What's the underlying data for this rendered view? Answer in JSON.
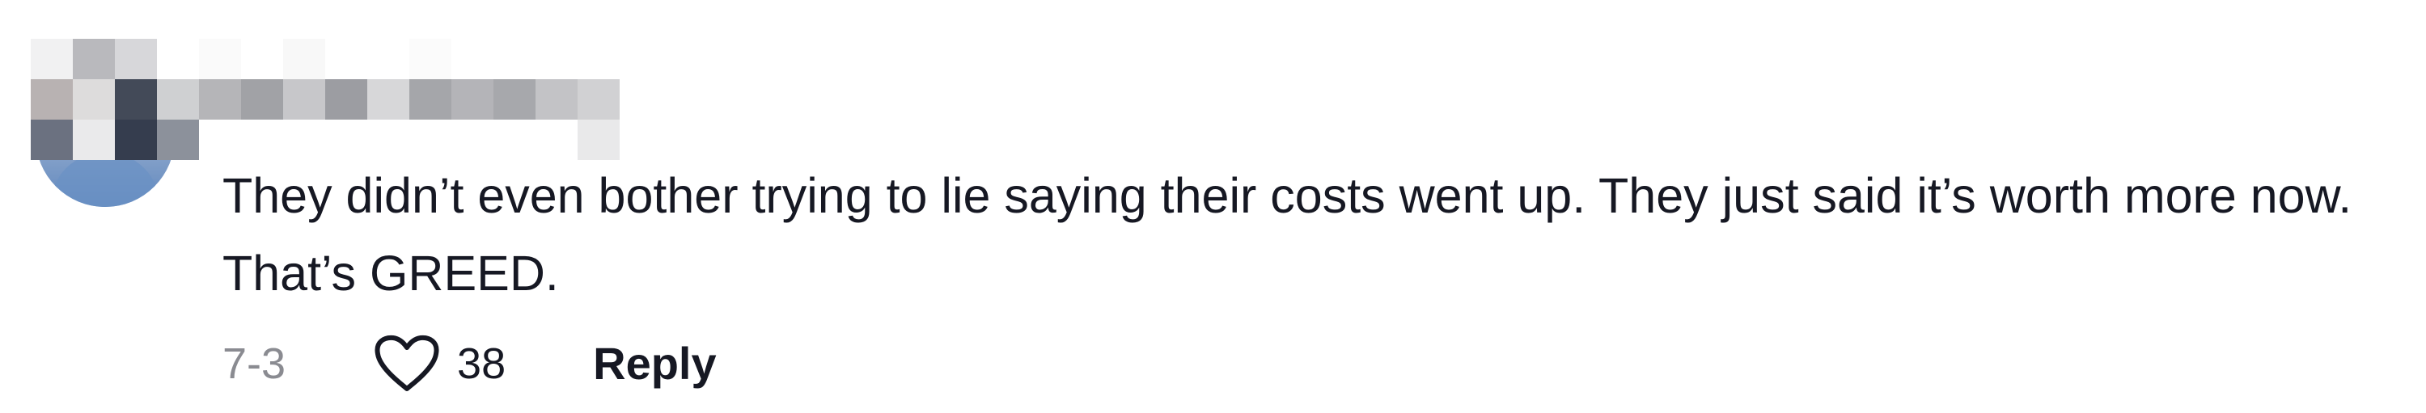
{
  "comment": {
    "text": "They didn’t even bother trying to lie saying their costs went up. They just said it’s worth more now. That’s GREED.",
    "date": "7-3",
    "likes": "38",
    "reply_label": "Reply"
  },
  "colors": {
    "text": "#161823",
    "muted": "#8a8b91",
    "blurred_name_pixels": [
      "#eeeeee",
      "#b8b7b9",
      "#d9d9da",
      "#f4f4f5",
      "#a4a5aa",
      "#3f4658"
    ]
  },
  "icons": {
    "like": "heart-outline-icon"
  }
}
